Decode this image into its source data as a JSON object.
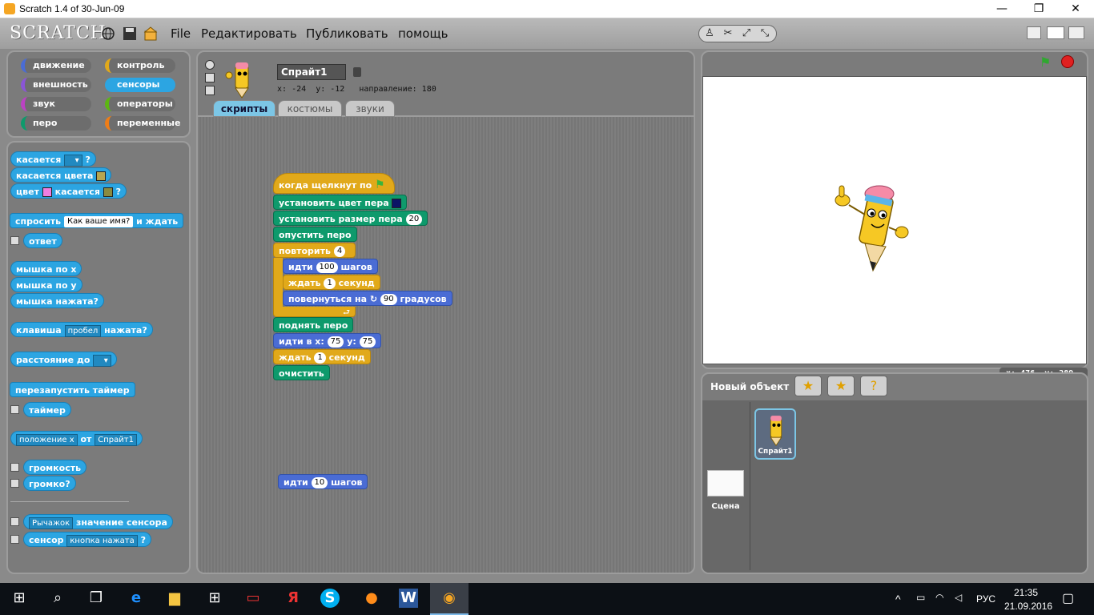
{
  "window": {
    "title": "Scratch 1.4 of 30-Jun-09",
    "minimize": "—",
    "maximize": "❐",
    "close": "✕"
  },
  "menu": {
    "logo": "SCRATCH",
    "file": "File",
    "edit": "Редактировать",
    "publish": "Публиковать",
    "help": "помощь"
  },
  "categories": {
    "motion": "движение",
    "looks": "внешность",
    "sound": "звук",
    "pen": "перо",
    "control": "контроль",
    "sensing": "сенсоры",
    "operators": "операторы",
    "variables": "переменные"
  },
  "palette": {
    "touching": "касается",
    "q": "?",
    "touching_color": "касается цвета",
    "color": "цвет",
    "touches": "касается",
    "ask": "спросить",
    "ask_default": "Как ваше имя?",
    "and_wait": "и ждать",
    "answer": "ответ",
    "mouse_x": "мышка по x",
    "mouse_y": "мышка по y",
    "mouse_down": "мышка нажата?",
    "key": "клавиша",
    "key_val": "пробел",
    "pressed": "нажата?",
    "distance": "расстояние до",
    "reset_timer": "перезапустить таймер",
    "timer": "таймер",
    "prop": "положение x",
    "of": "от",
    "sprite_opt": "Спрайт1",
    "loudness": "громкость",
    "loud": "громко?",
    "slider": "Рычажок",
    "sensor_value": "значение сенсора",
    "sensor": "сенсор",
    "button_pressed": "кнопка нажата"
  },
  "sprite": {
    "name": "Спрайт1",
    "x_label": "x:",
    "x": "-24",
    "y_label": "y:",
    "y": "-12",
    "dir_label": "направление:",
    "dir": "180"
  },
  "tabs": {
    "scripts": "скрипты",
    "costumes": "костюмы",
    "sounds": "звуки"
  },
  "script": {
    "hat": "когда щелкнут по",
    "setcolor": "установить цвет пера",
    "setsize": "установить размер пера",
    "size": "20",
    "pendown": "опустить перо",
    "repeat": "повторить",
    "rep": "4",
    "move": "идти",
    "steps": "100",
    "steps_lbl": "шагов",
    "wait": "ждать",
    "secs": "1",
    "secs_lbl": "секунд",
    "turn": "повернуться на",
    "deg": "90",
    "deg_lbl": "градусов",
    "penup": "поднять перо",
    "goto": "идти в x:",
    "gx": "75",
    "y_lbl": "y:",
    "gy": "75",
    "wait2": "ждать",
    "secs2": "1",
    "secs2_lbl": "секунд",
    "clear": "очистить",
    "loose_move": "идти",
    "loose_steps": "10",
    "loose_lbl": "шагов"
  },
  "stage": {
    "mouse_x_label": "x:",
    "mouse_x": "-476",
    "mouse_y_label": "y:",
    "mouse_y": "-289"
  },
  "sprites_pane": {
    "new_sprite": "Новый объект",
    "thumb": "Спрайт1",
    "stage_label": "Сцена"
  },
  "taskbar": {
    "lang": "РУС",
    "time": "21:35",
    "date": "21.09.2016"
  },
  "colors": {
    "motion": "#4a6cd4",
    "control": "#e1a91a",
    "sensing": "#2ca5e2",
    "pen": "#0e9a6c"
  }
}
